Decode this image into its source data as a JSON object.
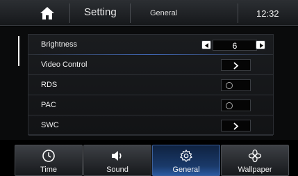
{
  "header": {
    "title": "Setting",
    "subtitle": "General",
    "time": "12:32",
    "home_icon": "home-icon"
  },
  "settings": {
    "brightness": {
      "label": "Brightness",
      "value": "6"
    },
    "video_control": {
      "label": "Video Control"
    },
    "rds": {
      "label": "RDS",
      "state": "off"
    },
    "pac": {
      "label": "PAC",
      "state": "off"
    },
    "swc": {
      "label": "SWC"
    }
  },
  "tabs": [
    {
      "label": "Time",
      "icon": "clock-icon",
      "active": false
    },
    {
      "label": "Sound",
      "icon": "speaker-icon",
      "active": false
    },
    {
      "label": "General",
      "icon": "gear-icon",
      "active": true
    },
    {
      "label": "Wallpaper",
      "icon": "wallpaper-icon",
      "active": false
    }
  ],
  "colors": {
    "active_tab": "#1a3a6a",
    "background": "#000000",
    "accent_line": "#4678dc"
  }
}
